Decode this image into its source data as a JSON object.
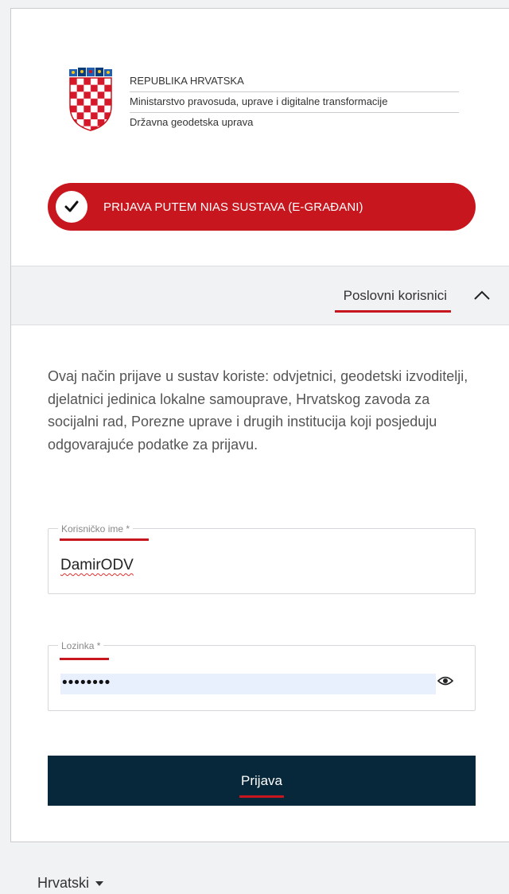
{
  "header": {
    "line1": "REPUBLIKA HRVATSKA",
    "line2": "Ministarstvo pravosuda, uprave i digitalne transformacije",
    "line3": "Državna geodetska uprava"
  },
  "nias_button": {
    "label": "PRIJAVA PUTEM NIAS SUSTAVA (E-GRAĐANI)",
    "icon": "check-icon"
  },
  "section": {
    "title": "Poslovni korisnici",
    "icon": "chevron-up-icon"
  },
  "description": "Ovaj način prijave u sustav koriste: odvjetnici, geodetski izvoditelji, djelatnici jedinica lokalne samouprave, Hrvatskog zavoda za socijalni rad, Porezne uprave i drugih institucija koji posjeduju odgovarajuće podatke za prijavu.",
  "username": {
    "label": "Korisničko ime *",
    "value": "DamirODV"
  },
  "password": {
    "label": "Lozinka *",
    "value": "••••••••",
    "icon": "eye-icon"
  },
  "submit": {
    "label": "Prijava"
  },
  "language": {
    "label": "Hrvatski",
    "icon": "caret-down-icon"
  },
  "colors": {
    "brand_red": "#c8161e",
    "dark_navy": "#07273a",
    "autofill": "#e8f0fe"
  }
}
